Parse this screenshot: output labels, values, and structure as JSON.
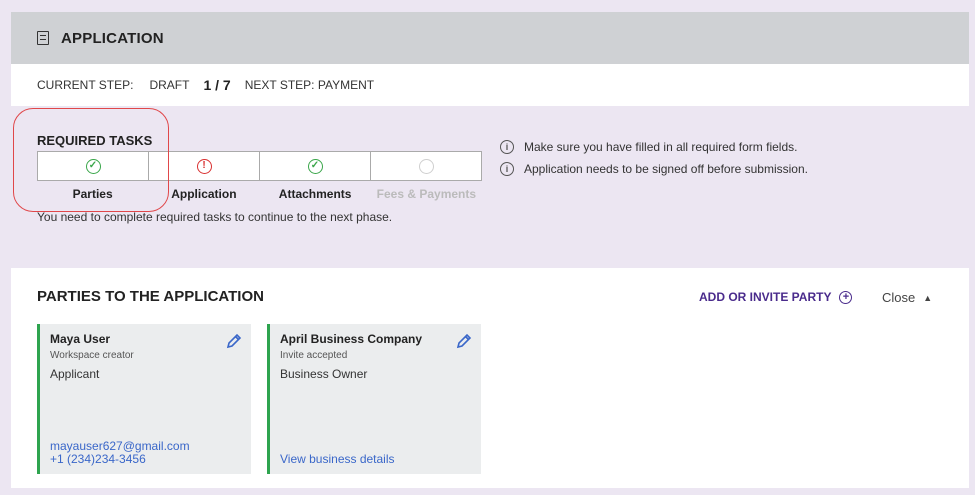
{
  "header": {
    "title": "APPLICATION",
    "icon": "document-icon"
  },
  "step_bar": {
    "current_label": "CURRENT STEP:",
    "current_value": "DRAFT",
    "count": "1 / 7",
    "next_label": "NEXT STEP: PAYMENT"
  },
  "required_tasks": {
    "heading": "REQUIRED TASKS",
    "items": [
      {
        "label": "Parties",
        "status": "complete"
      },
      {
        "label": "Application",
        "status": "error"
      },
      {
        "label": "Attachments",
        "status": "complete"
      },
      {
        "label": "Fees & Payments",
        "status": "disabled"
      }
    ],
    "note": "You need to complete required tasks to continue to the next phase."
  },
  "notices": [
    "Make sure you have filled in all required form fields.",
    "Application needs to be signed off before submission."
  ],
  "parties": {
    "title": "PARTIES TO THE APPLICATION",
    "add_label": "ADD OR INVITE PARTY",
    "close_label": "Close",
    "cards": [
      {
        "name": "Maya User",
        "sub": "Workspace creator",
        "role": "Applicant",
        "email": "mayauser627@gmail.com",
        "phone": "+1 (234)234-3456"
      },
      {
        "name": "April Business Company",
        "sub": "Invite accepted",
        "role": "Business Owner",
        "link": "View business details"
      }
    ]
  },
  "colors": {
    "accent": "#4a2b8c",
    "success": "#3aa64a",
    "error": "#d93030",
    "card_border": "#2ea44f",
    "link": "#3a67c9"
  }
}
